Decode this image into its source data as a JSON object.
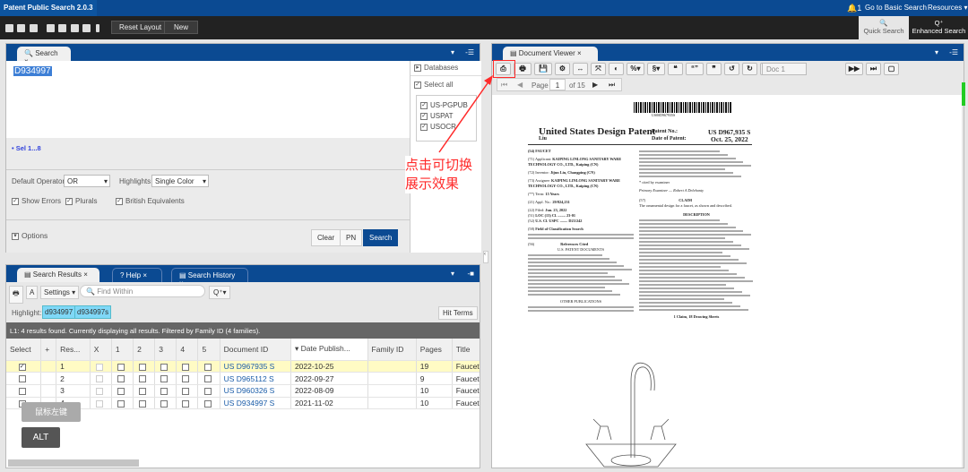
{
  "app": {
    "title": "Patent Public Search 2.0.3",
    "notif_count": "1",
    "basic_search": "Go to Basic Search",
    "resources": "Resources ▾"
  },
  "toolbar": {
    "reset_layout": "Reset Layout",
    "new": "New",
    "quick_search": "Quick Search",
    "enhanced_search": "Enhanced Search"
  },
  "search": {
    "tab": "Search",
    "query": "D934997",
    "sel": "Sel 1...8",
    "default_operator_label": "Default Operator",
    "default_operator": "OR",
    "highlights_label": "Highlights",
    "highlights": "Single Color",
    "show_errors": "Show Errors",
    "plurals": "Plurals",
    "british": "British Equivalents",
    "options": "Options",
    "clear": "Clear",
    "pn": "PN",
    "search": "Search",
    "databases": "Databases",
    "select_all": "Select all",
    "dbs": [
      "US-PGPUB",
      "USPAT",
      "USOCR"
    ]
  },
  "annotation": {
    "line1": "点击可切换",
    "line2": "展示效果",
    "color": "#ff2a2a",
    "mouse": "鼠标左键",
    "key": "ALT"
  },
  "results": {
    "tabs": [
      "Search Results",
      "Help",
      "Search History"
    ],
    "settings": "Settings",
    "find_placeholder": "Find Within",
    "highlight_label": "Highlight:",
    "terms": [
      "d934997",
      "d934997s"
    ],
    "hit_terms": "Hit Terms",
    "status": "L1:  4 results found. Currently displaying all results. Filtered by Family ID (4 families).",
    "columns": [
      "Select",
      "+",
      "Res...",
      "X",
      "1",
      "2",
      "3",
      "4",
      "5",
      "Document ID",
      "▾ Date Publish...",
      "Family ID",
      "Pages",
      "Title"
    ],
    "rows": [
      {
        "checked": true,
        "n": "1",
        "id": "US D967935 S",
        "date": "2022-10-25",
        "family": "",
        "pages": "19",
        "title": "Faucet"
      },
      {
        "checked": false,
        "n": "2",
        "id": "US D965112 S",
        "date": "2022-09-27",
        "family": "",
        "pages": "9",
        "title": "Faucet"
      },
      {
        "checked": false,
        "n": "3",
        "id": "US D960326 S",
        "date": "2022-08-09",
        "family": "",
        "pages": "10",
        "title": "Faucet"
      },
      {
        "checked": false,
        "n": "4",
        "id": "US D934997 S",
        "date": "2021-11-02",
        "family": "",
        "pages": "10",
        "title": "Faucet"
      }
    ]
  },
  "viewer": {
    "tab": "Document Viewer",
    "doc": "Doc 1",
    "page_label": "Page",
    "page": "1",
    "of": "of 15",
    "patent": {
      "barcode_text": "US00D967935S",
      "kind": "United States Design Patent",
      "inventor_short": "Liu",
      "patent_no_label": "Patent No.:",
      "patent_no": "US D967,935 S",
      "date_label": "Date of Patent:",
      "date": "Oct. 25, 2022",
      "title_code": "(54)",
      "title": "FAUCET",
      "applicant_label": "Applicant:",
      "applicant": "KAIPING LINLONG SANITARY WARE TECHNOLOGY CO., LTD., Kaiping (CN)",
      "inventor_label": "Inventor:",
      "inventor": "Jijun Liu, Changping (CN)",
      "assignee_label": "Assignee:",
      "assignee": "KAIPING LINLONG SANITARY WARE TECHNOLOGY CO., LTD., Kaiping (CN)",
      "term_label": "Term:",
      "term": "15 Years",
      "appl_label": "Appl. No.:",
      "appl": "29/824,231",
      "filed_label": "Filed:",
      "filed": "Jun. 23, 2022",
      "loc": "LOC (13) Cl. ........ 23-01",
      "uscl": "U.S. Cl.  USPC ........ D23/242",
      "field": "Field of Classification Search",
      "refs": "References Cited",
      "us_docs": "U.S. PATENT DOCUMENTS",
      "other": "OTHER PUBLICATIONS",
      "cited": "* cited by examiner",
      "examiner": "Primary Examiner — Robert A Delehanty",
      "claim_h": "CLAIM",
      "claim": "The ornamental design for a faucet, as shown and described.",
      "desc_h": "DESCRIPTION",
      "sheets": "1 Claim, 18 Drawing Sheets"
    }
  }
}
